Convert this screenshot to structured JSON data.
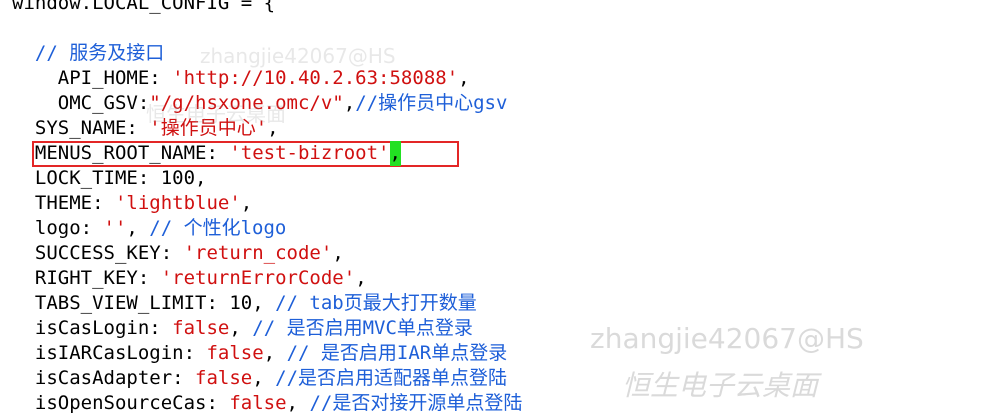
{
  "lines": [
    {
      "parts": [
        {
          "t": "window.LOCAL_CONFIG = {",
          "cls": "k"
        }
      ]
    },
    {
      "parts": []
    },
    {
      "parts": [
        {
          "t": "  // 服务及接口",
          "cls": "c"
        }
      ]
    },
    {
      "parts": [
        {
          "t": "    API_HOME: ",
          "cls": "k"
        },
        {
          "t": "'http://10.40.2.63:58088'",
          "cls": "s"
        },
        {
          "t": ",",
          "cls": "k"
        }
      ]
    },
    {
      "parts": [
        {
          "t": "    OMC_GSV:",
          "cls": "k"
        },
        {
          "t": "\"/g/hsxone.omc/v\"",
          "cls": "s"
        },
        {
          "t": ",",
          "cls": "k"
        },
        {
          "t": "//操作员中心gsv",
          "cls": "c"
        }
      ]
    },
    {
      "parts": [
        {
          "t": "  SYS_NAME: ",
          "cls": "k"
        },
        {
          "t": "'操作员中心'",
          "cls": "s"
        },
        {
          "t": ",",
          "cls": "k"
        }
      ]
    },
    {
      "parts": [
        {
          "t": "  MENUS_ROOT_NAME: ",
          "cls": "k"
        },
        {
          "t": "'test-bizroot'",
          "cls": "s"
        },
        {
          "t": ",",
          "cls": "cursor"
        }
      ]
    },
    {
      "parts": [
        {
          "t": "  LOCK_TIME: 100,",
          "cls": "k"
        }
      ]
    },
    {
      "parts": [
        {
          "t": "  THEME: ",
          "cls": "k"
        },
        {
          "t": "'lightblue'",
          "cls": "s"
        },
        {
          "t": ",",
          "cls": "k"
        }
      ]
    },
    {
      "parts": [
        {
          "t": "  logo: ",
          "cls": "k"
        },
        {
          "t": "''",
          "cls": "s"
        },
        {
          "t": ", ",
          "cls": "k"
        },
        {
          "t": "// 个性化logo",
          "cls": "c"
        }
      ]
    },
    {
      "parts": [
        {
          "t": "  SUCCESS_KEY: ",
          "cls": "k"
        },
        {
          "t": "'return_code'",
          "cls": "s"
        },
        {
          "t": ",",
          "cls": "k"
        }
      ]
    },
    {
      "parts": [
        {
          "t": "  RIGHT_KEY: ",
          "cls": "k"
        },
        {
          "t": "'returnErrorCode'",
          "cls": "s"
        },
        {
          "t": ",",
          "cls": "k"
        }
      ]
    },
    {
      "parts": [
        {
          "t": "  TABS_VIEW_LIMIT: 10, ",
          "cls": "k"
        },
        {
          "t": "// tab页最大打开数量",
          "cls": "c"
        }
      ]
    },
    {
      "parts": [
        {
          "t": "  isCasLogin: ",
          "cls": "k"
        },
        {
          "t": "false",
          "cls": "v"
        },
        {
          "t": ", ",
          "cls": "k"
        },
        {
          "t": "// 是否启用MVC单点登录",
          "cls": "c"
        }
      ]
    },
    {
      "parts": [
        {
          "t": "  isIARCasLogin: ",
          "cls": "k"
        },
        {
          "t": "false",
          "cls": "v"
        },
        {
          "t": ", ",
          "cls": "k"
        },
        {
          "t": "// 是否启用IAR单点登录",
          "cls": "c"
        }
      ]
    },
    {
      "parts": [
        {
          "t": "  isCasAdapter: ",
          "cls": "k"
        },
        {
          "t": "false",
          "cls": "v"
        },
        {
          "t": ", ",
          "cls": "k"
        },
        {
          "t": "//是否启用适配器单点登陆",
          "cls": "c"
        }
      ]
    },
    {
      "parts": [
        {
          "t": "  isOpenSourceCas: ",
          "cls": "k"
        },
        {
          "t": "false",
          "cls": "v"
        },
        {
          "t": ", ",
          "cls": "k"
        },
        {
          "t": "//是否对接开源单点登陆",
          "cls": "c"
        }
      ]
    }
  ],
  "watermark": {
    "user": "zhangjie42067@HS",
    "company": "恒生电子云桌面"
  },
  "colors": {
    "keyword": "#000000",
    "string": "#d01010",
    "comment": "#1e5fd8",
    "cursor": "#22e022",
    "highlight_border": "#e32626"
  }
}
